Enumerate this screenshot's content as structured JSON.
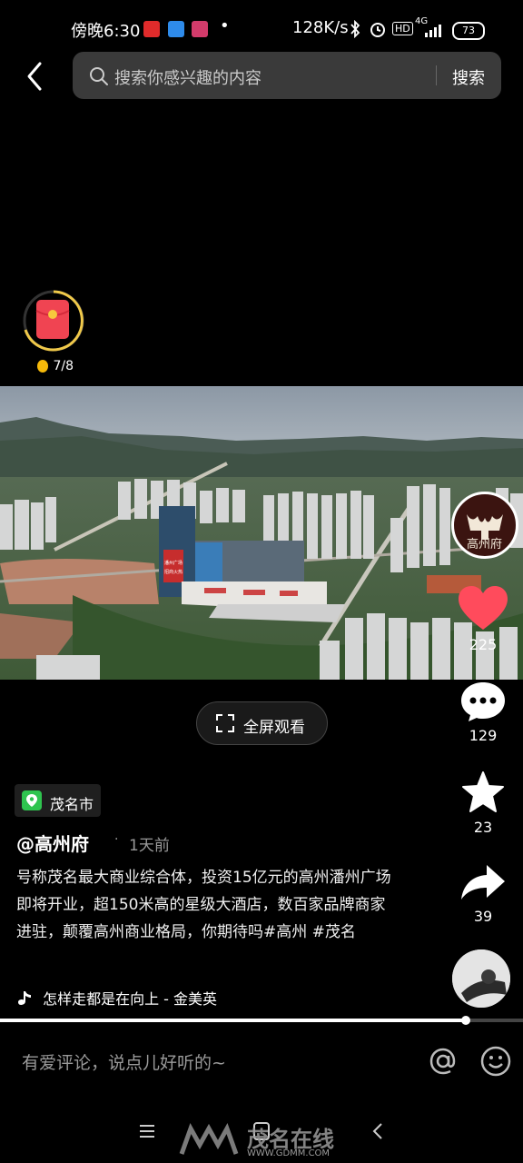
{
  "status_bar": {
    "time": "傍晚6:30",
    "dot": "•",
    "net_speed": "128K/s",
    "hd": "HD",
    "signal": "4G",
    "battery": "73"
  },
  "search": {
    "placeholder": "搜索你感兴趣的内容",
    "button": "搜索"
  },
  "red_packet": {
    "count": "7/8"
  },
  "video_overlay": {
    "billboard_lines": [
      "潘州广场",
      "招商火热"
    ]
  },
  "actions": {
    "likes": "225",
    "comments": "129",
    "favorites": "23",
    "shares": "39"
  },
  "avatar_text": "高州府",
  "fullscreen_label": "全屏观看",
  "location": "茂名市",
  "author": "@高州府",
  "time_ago": "1天前",
  "description": "号称茂名最大商业综合体，投资15亿元的高州潘州广场即将开业，超150米高的星级大酒店，数百家品牌商家进驻，颠覆高州商业格局，你期待吗#高州 #茂名",
  "music": "怎样走都是在向上 - 金美英",
  "progress": {
    "fraction": 0.89
  },
  "comment_placeholder": "有爱评论，说点儿好听的~",
  "watermark": {
    "brand": "茂名在线",
    "url": "WWW.GDMM.COM"
  },
  "colors": {
    "like": "#ff4b5c",
    "location": "#2fc44f"
  }
}
